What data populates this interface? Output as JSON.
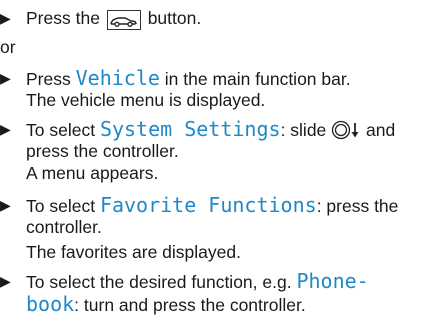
{
  "steps": {
    "s1": {
      "bullet": "▶",
      "before": "Press the",
      "icon": "car-button-icon",
      "after": "button."
    },
    "or_label": "or",
    "s2": {
      "bullet": "▶",
      "line1_before": "Press",
      "keyword": "Vehicle",
      "line1_after": "in the main function bar.",
      "line2": "The vehicle menu is displayed."
    },
    "s3": {
      "bullet": "▶",
      "line1_before": "To select",
      "keyword": "System Settings",
      "line1_mid": ": slide",
      "icon": "controller-slide-down-icon",
      "line1_after": "and",
      "line2": "press the controller.",
      "line3": "A menu appears."
    },
    "s4": {
      "bullet": "▶",
      "line1_before": "To select",
      "keyword": "Favorite Functions",
      "line1_after": ": press the",
      "line2": "controller.",
      "line3": "The favorites are displayed."
    },
    "s5": {
      "bullet": "▶",
      "line1_before": "To select the desired function, e.g.",
      "keyword_part1": "Phone-",
      "keyword_part2": "book",
      "line2_after": ": turn and press the controller."
    }
  },
  "colors": {
    "keyword": "#1f88c9",
    "text": "#1a1a1a"
  }
}
